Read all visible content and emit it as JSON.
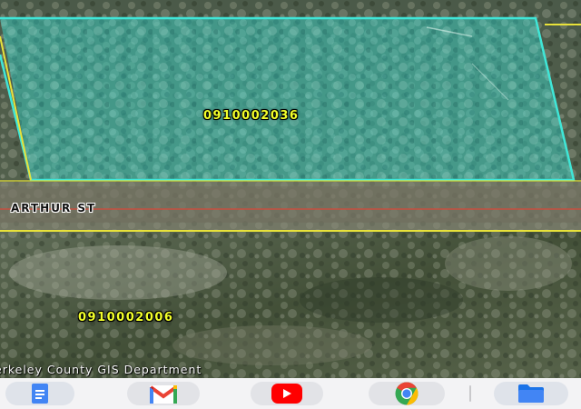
{
  "map": {
    "parcels": [
      {
        "id": "0910002036",
        "highlighted": true,
        "highlight_color": "#3fe6d8"
      },
      {
        "id": "0910002006",
        "highlighted": false
      }
    ],
    "street": {
      "name": "ARTHUR ST",
      "line_color": "#d64a3a"
    },
    "parcel_line_color": "#e8e23a",
    "attribution": "erkeley County GIS Department"
  },
  "dock": {
    "apps": [
      {
        "name": "docs",
        "icon": "docs-icon",
        "color": "#4285f4"
      },
      {
        "name": "gmail",
        "icon": "gmail-icon",
        "color": "#ea4335"
      },
      {
        "name": "youtube",
        "icon": "youtube-icon",
        "color": "#ff0000"
      },
      {
        "name": "chrome",
        "icon": "chrome-icon",
        "color": "#34a853"
      },
      {
        "name": "files",
        "icon": "files-icon",
        "color": "#1a73e8"
      }
    ]
  }
}
